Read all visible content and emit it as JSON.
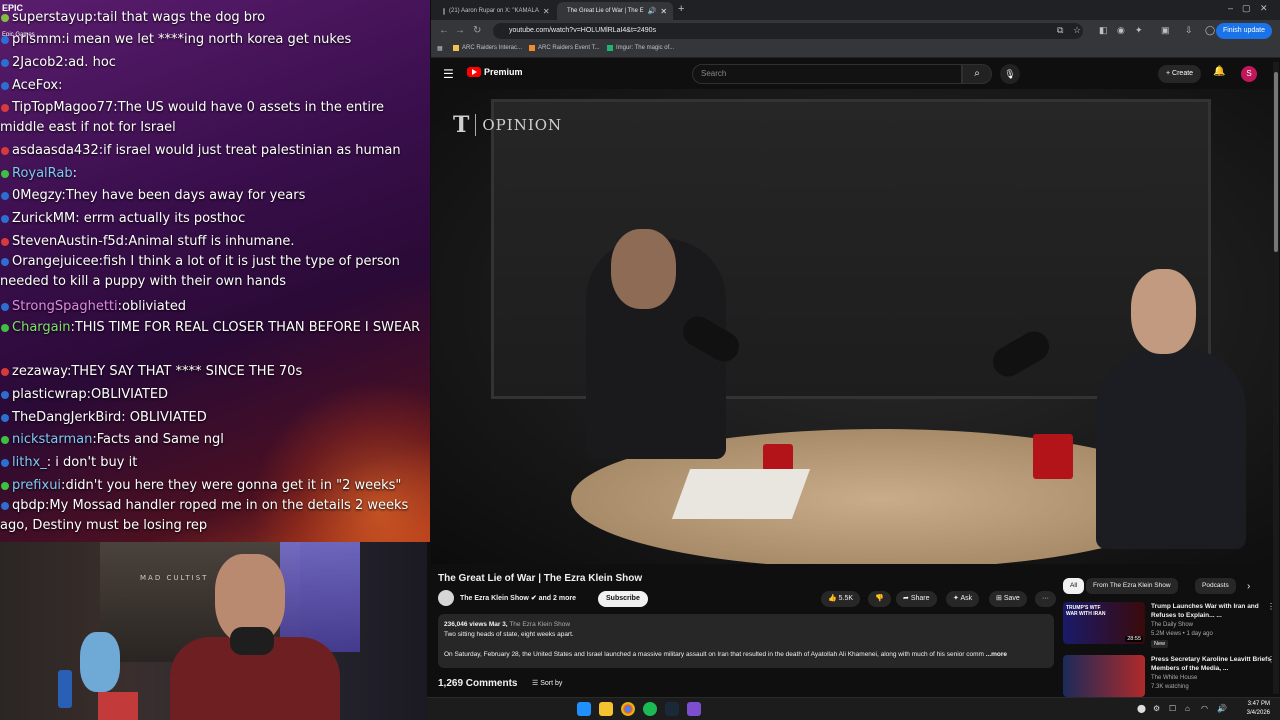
{
  "chat": {
    "overlay_label": "EPIC",
    "overlay_sub": "Epic Games",
    "messages": [
      {
        "user": "superstayup",
        "sep": ":",
        "text": "tail that wags the dog bro",
        "color": "#ffffff",
        "badge": "#7fbf3f"
      },
      {
        "user": "prismm",
        "sep": ":",
        "text": "i mean we let ****ing north korea get nukes",
        "color": "#ffffff",
        "badge": "#2a6fd1"
      },
      {
        "user": "2Jacob2",
        "sep": ":",
        "text": "ad. hoc",
        "color": "#ffffff",
        "badge": "#2a6fd1"
      },
      {
        "user": "AceFox",
        "sep": ":",
        "text": "",
        "color": "#ffffff",
        "badge": "#2a6fd1"
      },
      {
        "user": "TipTopMagoo77",
        "sep": ":",
        "text": "The US would have 0 assets in the entire middle east if not for Israel",
        "color": "#ffffff",
        "badge": "#d63a3a"
      },
      {
        "user": "asdaasda432",
        "sep": ":",
        "text": "if israel would just treat palestinian as human",
        "color": "#ffffff",
        "badge": "#d63a3a"
      },
      {
        "user": "RoyalRab",
        "sep": ":",
        "text": "",
        "color": "#7ec8f5",
        "badge": "#3fbf3f"
      },
      {
        "user": "0Megzy",
        "sep": ":",
        "text": "They have been days away for years",
        "color": "#ffffff",
        "badge": "#2a6fd1"
      },
      {
        "user": "ZurickMM",
        "sep": ":",
        "text": " errm actually its posthoc",
        "color": "#ffffff",
        "badge": "#2a6fd1"
      },
      {
        "user": "StevenAustin-f5d",
        "sep": ":",
        "text": "Animal stuff is inhumane.",
        "color": "#ffffff",
        "badge": "#d63a3a"
      },
      {
        "user": "Orangejuicee",
        "sep": ":",
        "text": "fish  I think a lot of it is just the type of person needed to kill a puppy with their own hands",
        "color": "#ffffff",
        "badge": "#2a6fd1"
      },
      {
        "user": "StrongSpaghetti",
        "sep": ":",
        "text": "obliviated",
        "color": "#e089e6",
        "badge": "#2a6fd1"
      },
      {
        "user": "Chargain",
        "sep": ":",
        "text": "THIS TIME FOR REAL  CLOSER THAN BEFORE I SWEAR",
        "color": "#7ee06a",
        "badge": "#3fbf3f"
      },
      {
        "user": "zezaway",
        "sep": ":",
        "text": "THEY SAY THAT **** SINCE THE 70s",
        "color": "#ffffff",
        "badge": "#d63a3a"
      },
      {
        "user": "plasticwrap",
        "sep": ":",
        "text": "OBLIVIATED",
        "color": "#ffffff",
        "badge": "#2a6fd1"
      },
      {
        "user": "TheDangJerkBird",
        "sep": ":",
        "text": " OBLIVIATED",
        "color": "#ffffff",
        "badge": "#2a6fd1"
      },
      {
        "user": "nickstarman",
        "sep": ":",
        "text": "Facts and Same ngl",
        "color": "#7ec8f5",
        "badge": "#3fbf3f"
      },
      {
        "user": "lithx_",
        "sep": ":",
        "text": " i don't buy it",
        "color": "#7ec8f5",
        "badge": "#2a6fd1"
      },
      {
        "user": "prefixui",
        "sep": ":",
        "text": "didn't you here they were gonna get it in \"2 weeks\"",
        "color": "#7ec8f5",
        "badge": "#3fbf3f"
      },
      {
        "user": "qbdp",
        "sep": ":",
        "text": "My Mossad handler roped me in on the details 2 weeks ago, Destiny must be losing rep",
        "color": "#ffffff",
        "badge": "#2a6fd1"
      }
    ]
  },
  "webcam": {
    "poster_text": "MAD CULTIST"
  },
  "browser": {
    "tabs": [
      {
        "label": "(21) Aaron Rupar on X: \"KAMALA",
        "favicon_color": "#000000"
      },
      {
        "label": "The Great Lie of War | The E",
        "favicon_color": "#ff0000"
      }
    ],
    "new_tab": "+",
    "url": "youtube.com/watch?v=HOLUMlRLaI4&t=2490s",
    "finish_update": "Finish update",
    "bookmarks": [
      {
        "label": "ARC Raiders Interac...",
        "color": "#f2c14e"
      },
      {
        "label": "ARC Raiders Event T...",
        "color": "#f28a2e"
      },
      {
        "label": "Imgur: The magic of...",
        "color": "#1bb76e"
      }
    ]
  },
  "youtube": {
    "logo_text": "Premium",
    "search_placeholder": "Search",
    "create_label": "Create",
    "avatar_letter": "S",
    "video": {
      "overlay_logo": "T",
      "overlay_label": "OPINION",
      "title": "The Great Lie of War | The Ezra Klein Show",
      "channel": "The Ezra Klein Show",
      "channel_suffix": "and 2 more",
      "subscribe": "Subscribe",
      "likes": "5.5K",
      "share": "Share",
      "ask": "Ask",
      "save": "Save",
      "more": "···",
      "views": "236,046 views",
      "date": "Mar 3,",
      "desc_channel": "The Ezra Klein Show",
      "desc_line1": "Two sitting heads of state, eight weeks apart.",
      "desc_line2": "On Saturday, February 28, the United States and Israel launched a massive military assault on Iran that resulted in the death of Ayatollah Ali Khamenei, along with much of his senior comm",
      "desc_more": "...more",
      "comments": "1,269 Comments",
      "sort_by": "Sort by"
    },
    "chips": [
      "All",
      "From The Ezra Klein Show",
      "Podcasts"
    ],
    "recommendations": [
      {
        "title": "Trump Launches War with Iran and Refuses to Explain... ...",
        "channel": "The Daily Show",
        "stats": "5.2M views • 1 day ago",
        "badge": "New",
        "duration": "28:55",
        "thumb_text": "TRUMP'S WTF WAR WITH IRAN"
      },
      {
        "title": "Press Secretary Karoline Leavitt Briefs Members of the Media, ...",
        "channel": "The White House",
        "stats": "7.3K watching",
        "badge": "",
        "duration": "",
        "thumb_text": ""
      }
    ]
  },
  "taskbar": {
    "time": "3:47 PM",
    "date": "3/4/2026"
  }
}
